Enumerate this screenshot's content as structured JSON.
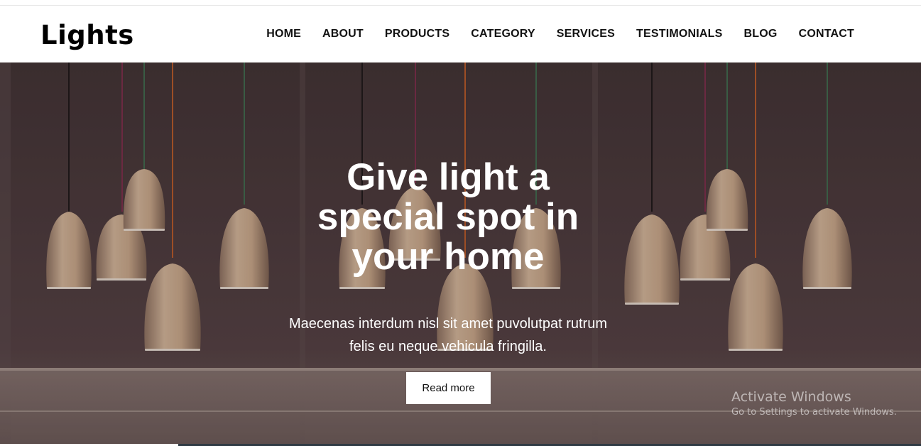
{
  "header": {
    "logo": "Lights",
    "nav": [
      "HOME",
      "ABOUT",
      "PRODUCTS",
      "CATEGORY",
      "SERVICES",
      "TESTIMONIALS",
      "BLOG",
      "CONTACT"
    ]
  },
  "hero": {
    "title": "Give light a special spot in your home",
    "text": "Maecenas interdum nisl sit amet puvolutpat rutrum felis eu neque vehicula fringilla.",
    "button_label": "Read more"
  },
  "watermark": {
    "title": "Activate Windows",
    "subtitle": "Go to Settings to activate Windows."
  },
  "colors": {
    "hero_bg": "#4a3b3e",
    "lamp": "#c9a98a",
    "nav_text": "#111111"
  }
}
